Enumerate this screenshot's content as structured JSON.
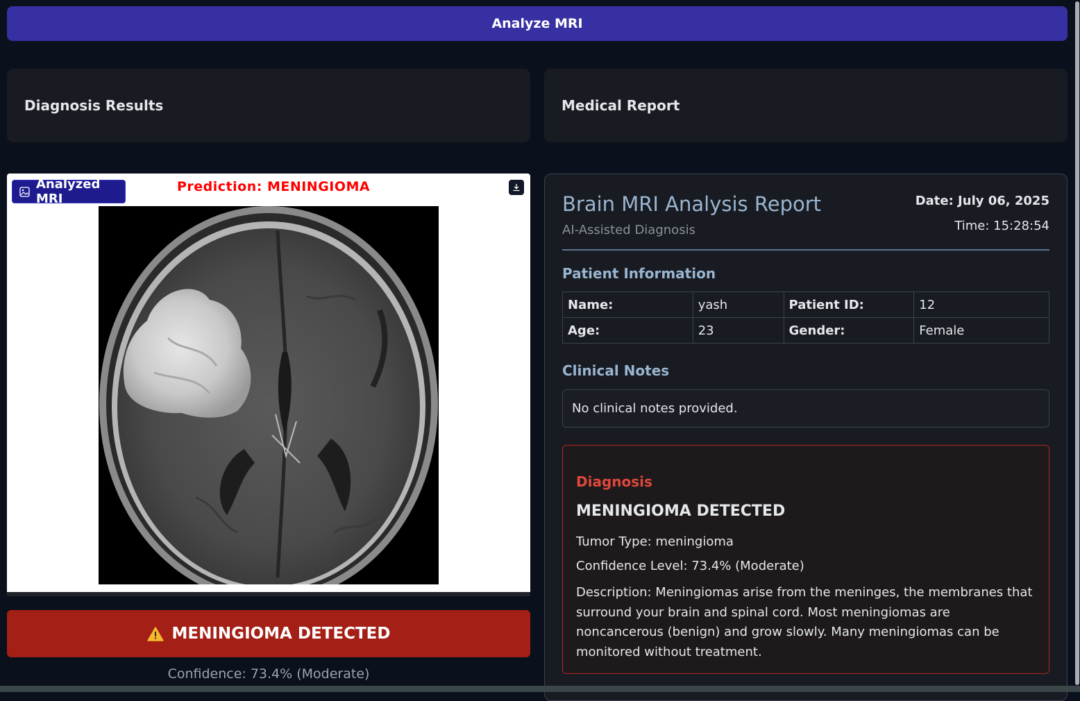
{
  "actions": {
    "analyze_label": "Analyze MRI"
  },
  "sections": {
    "diagnosis_results": "Diagnosis Results",
    "medical_report": "Medical Report"
  },
  "image_panel": {
    "badge_label": "Analyzed MRI",
    "prediction_text": "Prediction: MENINGIOMA",
    "icons": {
      "badge": "image-icon",
      "download": "download-icon"
    }
  },
  "result": {
    "banner_text": "MENINGIOMA DETECTED",
    "banner_icon": "warning-icon",
    "confidence_text": "Confidence: 73.4% (Moderate)"
  },
  "report": {
    "title": "Brain MRI Analysis Report",
    "subtitle": "AI-Assisted Diagnosis",
    "date": "Date: July 06, 2025",
    "time": "Time: 15:28:54",
    "patient_heading": "Patient Information",
    "patient": {
      "name_label": "Name:",
      "name": "yash",
      "id_label": "Patient ID:",
      "id": "12",
      "age_label": "Age:",
      "age": "23",
      "gender_label": "Gender:",
      "gender": "Female"
    },
    "notes_heading": "Clinical Notes",
    "notes": "No clinical notes provided.",
    "diagnosis": {
      "label": "Diagnosis",
      "title": "MENINGIOMA DETECTED",
      "tumor_type": "Tumor Type: meningioma",
      "confidence": "Confidence Level: 73.4% (Moderate)",
      "description": "Description: Meningiomas arise from the meninges, the membranes that surround your brain and spinal cord. Most meningiomas are noncancerous (benign) and grow slowly. Many meningiomas can be monitored without treatment."
    }
  },
  "colors": {
    "background": "#0b111c",
    "primary_button": "#3730a3",
    "card": "#181b21",
    "danger": "#a41f16",
    "prediction_red": "#ff0000",
    "report_accent": "#9ab5d0"
  }
}
